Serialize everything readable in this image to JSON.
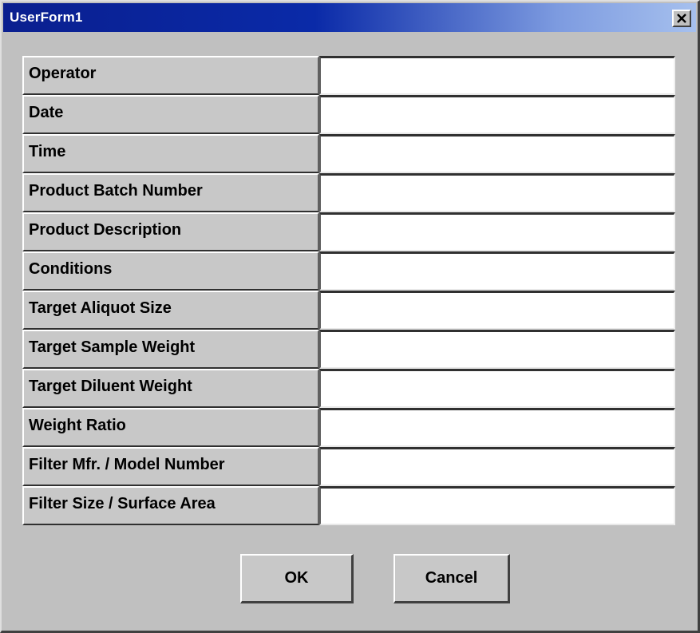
{
  "window": {
    "title": "UserForm1"
  },
  "form": {
    "fields": [
      {
        "label": "Operator",
        "value": ""
      },
      {
        "label": "Date",
        "value": ""
      },
      {
        "label": "Time",
        "value": ""
      },
      {
        "label": "Product Batch Number",
        "value": ""
      },
      {
        "label": "Product Description",
        "value": ""
      },
      {
        "label": "Conditions",
        "value": ""
      },
      {
        "label": "Target Aliquot Size",
        "value": ""
      },
      {
        "label": "Target Sample Weight",
        "value": ""
      },
      {
        "label": "Target Diluent Weight",
        "value": ""
      },
      {
        "label": "Weight Ratio",
        "value": ""
      },
      {
        "label": "Filter Mfr. / Model Number",
        "value": ""
      },
      {
        "label": "Filter Size / Surface Area",
        "value": ""
      }
    ]
  },
  "buttons": {
    "ok_label": "OK",
    "cancel_label": "Cancel"
  },
  "icons": {
    "close": "close-icon"
  },
  "colors": {
    "titlebar_start": "#0a1f8f",
    "titlebar_end": "#a6c0ee",
    "face": "#c0c0c0"
  }
}
